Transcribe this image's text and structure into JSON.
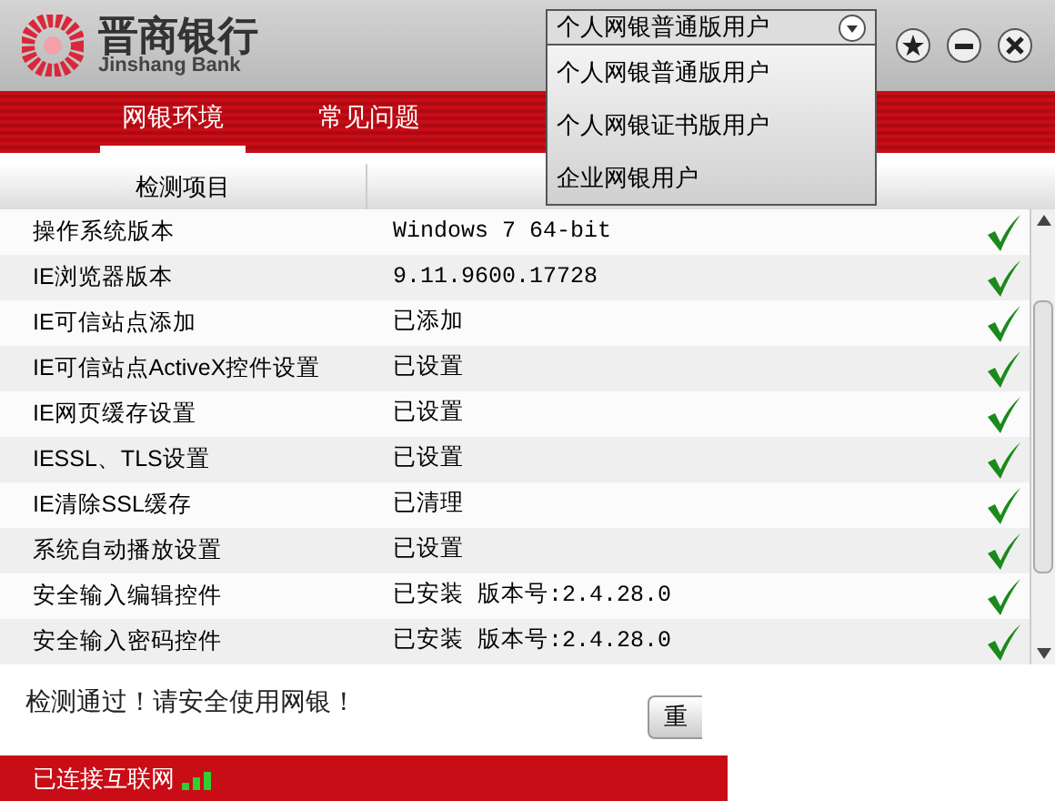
{
  "brand": {
    "name": "晋商银行",
    "subtitle": "Jinshang Bank"
  },
  "user_type": {
    "value": "个人网银普通版用户",
    "expanded": true,
    "options": [
      "个人网银普通版用户",
      "个人网银证书版用户",
      "企业网银用户"
    ]
  },
  "tabs": [
    {
      "label": "网银环境",
      "selected": true
    },
    {
      "label": "常见问题",
      "selected": false
    }
  ],
  "table": {
    "columns": [
      "检测项目"
    ],
    "rows": [
      {
        "item": "操作系统版本",
        "result": "Windows 7 64-bit",
        "passed": true
      },
      {
        "item": "IE浏览器版本",
        "result": "9.11.9600.17728",
        "passed": true
      },
      {
        "item": "IE可信站点添加",
        "result": "已添加",
        "passed": true
      },
      {
        "item": "IE可信站点ActiveX控件设置",
        "result": "已设置",
        "passed": true
      },
      {
        "item": "IE网页缓存设置",
        "result": "已设置",
        "passed": true
      },
      {
        "item": "IESSL、TLS设置",
        "result": "已设置",
        "passed": true
      },
      {
        "item": "IE清除SSL缓存",
        "result": "已清理",
        "passed": true
      },
      {
        "item": "系统自动播放设置",
        "result": "已设置",
        "passed": true
      },
      {
        "item": "安全输入编辑控件",
        "result": "已安装 版本号:2.4.28.0",
        "passed": true
      },
      {
        "item": "安全输入密码控件",
        "result": "已安装 版本号:2.4.28.0",
        "passed": true
      }
    ]
  },
  "message": "检测通过！请安全使用网银！",
  "recheck_button": "重",
  "status_bar": {
    "text": "已连接互联网"
  }
}
